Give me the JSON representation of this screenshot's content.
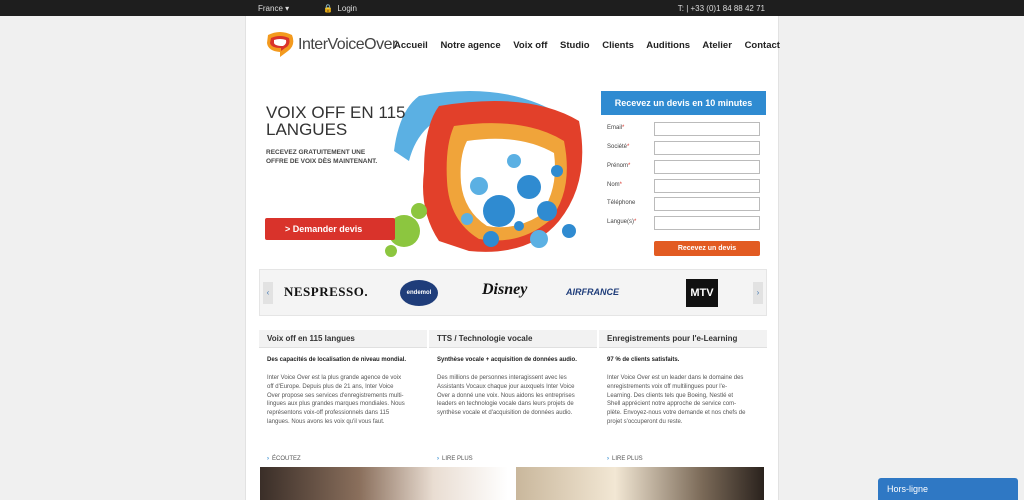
{
  "topbar": {
    "country": "France",
    "login": "Login",
    "phone": "T: | +33 (0)1 84 88 42 71"
  },
  "logo": {
    "text": "InterVoiceOver"
  },
  "nav": {
    "items": [
      "Accueil",
      "Notre agence",
      "Voix off",
      "Studio",
      "Clients",
      "Auditions",
      "Atelier",
      "Contact"
    ]
  },
  "hero": {
    "title_line1": "VOIX OFF EN 115",
    "title_line2": "LANGUES",
    "sub_line1": "RECEVEZ GRATUITEMENT UNE",
    "sub_line2": "OFFRE DE VOIX DÈS MAINTENANT.",
    "button": "> Demander devis"
  },
  "quote_form": {
    "title": "Recevez un devis en 10 minutes",
    "fields": [
      {
        "label": "Email",
        "required": true
      },
      {
        "label": "Société",
        "required": true
      },
      {
        "label": "Prénom",
        "required": true
      },
      {
        "label": "Nom",
        "required": true
      },
      {
        "label": "Téléphone",
        "required": false
      },
      {
        "label": "Langue(s)",
        "required": true
      }
    ],
    "required_mark": "*",
    "submit": "Recevez un devis"
  },
  "clients": {
    "logos": [
      "NESPRESSO.",
      "endemol",
      "Disney",
      "AIRFRANCE",
      "MTV"
    ],
    "prev": "‹",
    "next": "›"
  },
  "columns": [
    {
      "title": "Voix off en 115 langues",
      "lead": "Des capacités de localisation de niveau mondial.",
      "body": [
        "Inter Voice Over est la plus grande agence de voix",
        "off d'Europe. Depuis plus de 21 ans, Inter Voice",
        "Over propose ses services d'enregistrements multi-",
        "lingues aux plus grandes marques mondiales. Nous",
        "représentons voix-off professionnels dans 115",
        "langues. Nous avons les voix qu'il vous faut."
      ],
      "more": "ÉCOUTEZ"
    },
    {
      "title": "TTS / Technologie vocale",
      "lead": "Synthèse vocale + acquisition de données audio.",
      "body": [
        "Des millions de personnes interagissent avec les",
        "Assistants Vocaux chaque jour auxquels Inter Voice",
        "Over a donné une voix. Nous aidons les entreprises",
        "leaders en technologie vocale dans leurs projets de",
        "synthèse vocale et d'acquisition de données audio."
      ],
      "more": "LIRE PLUS"
    },
    {
      "title": "Enregistrements pour l'e-Learning",
      "lead": "97 % de clients satisfaits.",
      "body": [
        "Inter Voice Over est un leader dans le domaine des",
        "enregistrements voix off multilingues pour l'e-",
        "Learning. Des clients tels que Boeing, Nestlé et",
        "Shell apprécient notre approche de service com-",
        "plète. Envoyez-nous votre demande et nos chefs de",
        "projet s'occuperont du reste."
      ],
      "more": "LIRE PLUS"
    }
  ],
  "chat": {
    "label": "Hors-ligne"
  },
  "colors": {
    "red": "#d9332b",
    "blue": "#2f8bd1",
    "orange": "#e25b22",
    "topbar": "#1e1e1e"
  }
}
